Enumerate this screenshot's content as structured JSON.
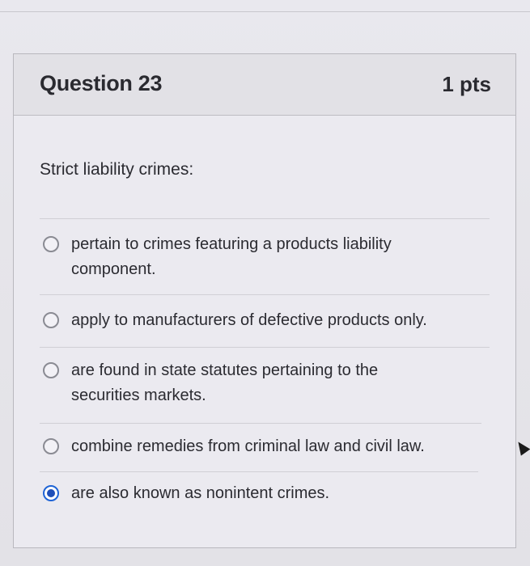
{
  "question": {
    "title": "Question 23",
    "points": "1 pts",
    "prompt": "Strict liability crimes:"
  },
  "answers": [
    {
      "label": "pertain to crimes featuring a products liability component.",
      "selected": false
    },
    {
      "label": "apply to manufacturers of defective products only.",
      "selected": false
    },
    {
      "label": "are found in state statutes pertaining to the securities markets.",
      "selected": false
    },
    {
      "label": "combine remedies from criminal law and civil law.",
      "selected": false
    },
    {
      "label": "are also known as nonintent crimes.",
      "selected": true
    }
  ],
  "colors": {
    "selected_radio": "#1f4fb8",
    "page_background": "#e7e6eb"
  }
}
